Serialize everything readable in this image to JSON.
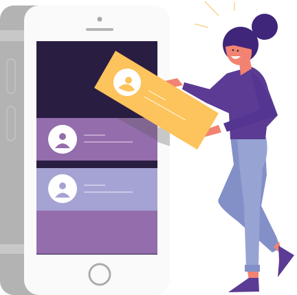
{
  "illustration": {
    "subject": "phone-profile-cards",
    "colors": {
      "phone_back": "#b3b3b3",
      "phone_front": "#fafafa",
      "screen_dark": "#2a1d42",
      "card_purple": "#946dac",
      "card_lavender": "#a5a3d3",
      "card_yellow": "#fdc35c",
      "hair": "#3f267a",
      "skin": "#f28372",
      "sweater": "#5b3b94",
      "pants": "#97a3d3",
      "pants_shade": "#8390c8",
      "shoes": "#5b3b94",
      "spark": "#f8d58a"
    }
  }
}
